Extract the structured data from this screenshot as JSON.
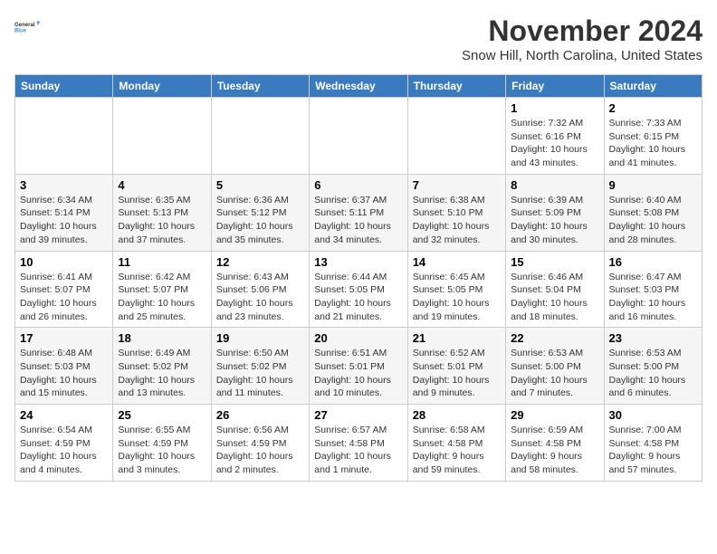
{
  "logo": {
    "line1": "General",
    "line2": "Blue"
  },
  "title": "November 2024",
  "subtitle": "Snow Hill, North Carolina, United States",
  "days_of_week": [
    "Sunday",
    "Monday",
    "Tuesday",
    "Wednesday",
    "Thursday",
    "Friday",
    "Saturday"
  ],
  "weeks": [
    [
      {
        "day": "",
        "info": ""
      },
      {
        "day": "",
        "info": ""
      },
      {
        "day": "",
        "info": ""
      },
      {
        "day": "",
        "info": ""
      },
      {
        "day": "",
        "info": ""
      },
      {
        "day": "1",
        "info": "Sunrise: 7:32 AM\nSunset: 6:16 PM\nDaylight: 10 hours and 43 minutes."
      },
      {
        "day": "2",
        "info": "Sunrise: 7:33 AM\nSunset: 6:15 PM\nDaylight: 10 hours and 41 minutes."
      }
    ],
    [
      {
        "day": "3",
        "info": "Sunrise: 6:34 AM\nSunset: 5:14 PM\nDaylight: 10 hours and 39 minutes."
      },
      {
        "day": "4",
        "info": "Sunrise: 6:35 AM\nSunset: 5:13 PM\nDaylight: 10 hours and 37 minutes."
      },
      {
        "day": "5",
        "info": "Sunrise: 6:36 AM\nSunset: 5:12 PM\nDaylight: 10 hours and 35 minutes."
      },
      {
        "day": "6",
        "info": "Sunrise: 6:37 AM\nSunset: 5:11 PM\nDaylight: 10 hours and 34 minutes."
      },
      {
        "day": "7",
        "info": "Sunrise: 6:38 AM\nSunset: 5:10 PM\nDaylight: 10 hours and 32 minutes."
      },
      {
        "day": "8",
        "info": "Sunrise: 6:39 AM\nSunset: 5:09 PM\nDaylight: 10 hours and 30 minutes."
      },
      {
        "day": "9",
        "info": "Sunrise: 6:40 AM\nSunset: 5:08 PM\nDaylight: 10 hours and 28 minutes."
      }
    ],
    [
      {
        "day": "10",
        "info": "Sunrise: 6:41 AM\nSunset: 5:07 PM\nDaylight: 10 hours and 26 minutes."
      },
      {
        "day": "11",
        "info": "Sunrise: 6:42 AM\nSunset: 5:07 PM\nDaylight: 10 hours and 25 minutes."
      },
      {
        "day": "12",
        "info": "Sunrise: 6:43 AM\nSunset: 5:06 PM\nDaylight: 10 hours and 23 minutes."
      },
      {
        "day": "13",
        "info": "Sunrise: 6:44 AM\nSunset: 5:05 PM\nDaylight: 10 hours and 21 minutes."
      },
      {
        "day": "14",
        "info": "Sunrise: 6:45 AM\nSunset: 5:05 PM\nDaylight: 10 hours and 19 minutes."
      },
      {
        "day": "15",
        "info": "Sunrise: 6:46 AM\nSunset: 5:04 PM\nDaylight: 10 hours and 18 minutes."
      },
      {
        "day": "16",
        "info": "Sunrise: 6:47 AM\nSunset: 5:03 PM\nDaylight: 10 hours and 16 minutes."
      }
    ],
    [
      {
        "day": "17",
        "info": "Sunrise: 6:48 AM\nSunset: 5:03 PM\nDaylight: 10 hours and 15 minutes."
      },
      {
        "day": "18",
        "info": "Sunrise: 6:49 AM\nSunset: 5:02 PM\nDaylight: 10 hours and 13 minutes."
      },
      {
        "day": "19",
        "info": "Sunrise: 6:50 AM\nSunset: 5:02 PM\nDaylight: 10 hours and 11 minutes."
      },
      {
        "day": "20",
        "info": "Sunrise: 6:51 AM\nSunset: 5:01 PM\nDaylight: 10 hours and 10 minutes."
      },
      {
        "day": "21",
        "info": "Sunrise: 6:52 AM\nSunset: 5:01 PM\nDaylight: 10 hours and 9 minutes."
      },
      {
        "day": "22",
        "info": "Sunrise: 6:53 AM\nSunset: 5:00 PM\nDaylight: 10 hours and 7 minutes."
      },
      {
        "day": "23",
        "info": "Sunrise: 6:53 AM\nSunset: 5:00 PM\nDaylight: 10 hours and 6 minutes."
      }
    ],
    [
      {
        "day": "24",
        "info": "Sunrise: 6:54 AM\nSunset: 4:59 PM\nDaylight: 10 hours and 4 minutes."
      },
      {
        "day": "25",
        "info": "Sunrise: 6:55 AM\nSunset: 4:59 PM\nDaylight: 10 hours and 3 minutes."
      },
      {
        "day": "26",
        "info": "Sunrise: 6:56 AM\nSunset: 4:59 PM\nDaylight: 10 hours and 2 minutes."
      },
      {
        "day": "27",
        "info": "Sunrise: 6:57 AM\nSunset: 4:58 PM\nDaylight: 10 hours and 1 minute."
      },
      {
        "day": "28",
        "info": "Sunrise: 6:58 AM\nSunset: 4:58 PM\nDaylight: 9 hours and 59 minutes."
      },
      {
        "day": "29",
        "info": "Sunrise: 6:59 AM\nSunset: 4:58 PM\nDaylight: 9 hours and 58 minutes."
      },
      {
        "day": "30",
        "info": "Sunrise: 7:00 AM\nSunset: 4:58 PM\nDaylight: 9 hours and 57 minutes."
      }
    ]
  ]
}
